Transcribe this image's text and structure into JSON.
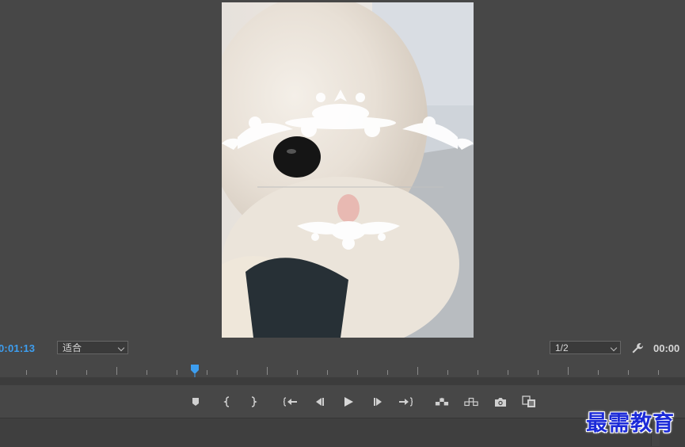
{
  "program_monitor": {
    "preview": {
      "description_icon": "video-preview"
    },
    "timecode_current": "0:01:13",
    "timecode_end": "00:00",
    "zoom_select": {
      "value": "适合"
    },
    "resolution_select": {
      "value": "1/2"
    }
  },
  "transport": {
    "buttons": [
      {
        "name": "add-marker",
        "icon": "marker-icon"
      },
      {
        "name": "mark-in",
        "icon": "mark-in-icon"
      },
      {
        "name": "mark-out",
        "icon": "mark-out-icon"
      },
      {
        "name": "go-to-in",
        "icon": "go-to-in-icon"
      },
      {
        "name": "step-back",
        "icon": "step-back-icon"
      },
      {
        "name": "play",
        "icon": "play-icon"
      },
      {
        "name": "step-forward",
        "icon": "step-forward-icon"
      },
      {
        "name": "go-to-out",
        "icon": "go-to-out-icon"
      },
      {
        "name": "lift",
        "icon": "lift-icon"
      },
      {
        "name": "extract",
        "icon": "extract-icon"
      },
      {
        "name": "export-frame",
        "icon": "camera-icon"
      },
      {
        "name": "compare-view",
        "icon": "compare-view-icon"
      }
    ]
  },
  "watermark": {
    "text": "最需教育"
  },
  "colors": {
    "panel_bg": "#474747",
    "timecode_accent": "#3d9ef0",
    "playhead": "#3d9ef0",
    "watermark": "#1c2bd8"
  }
}
